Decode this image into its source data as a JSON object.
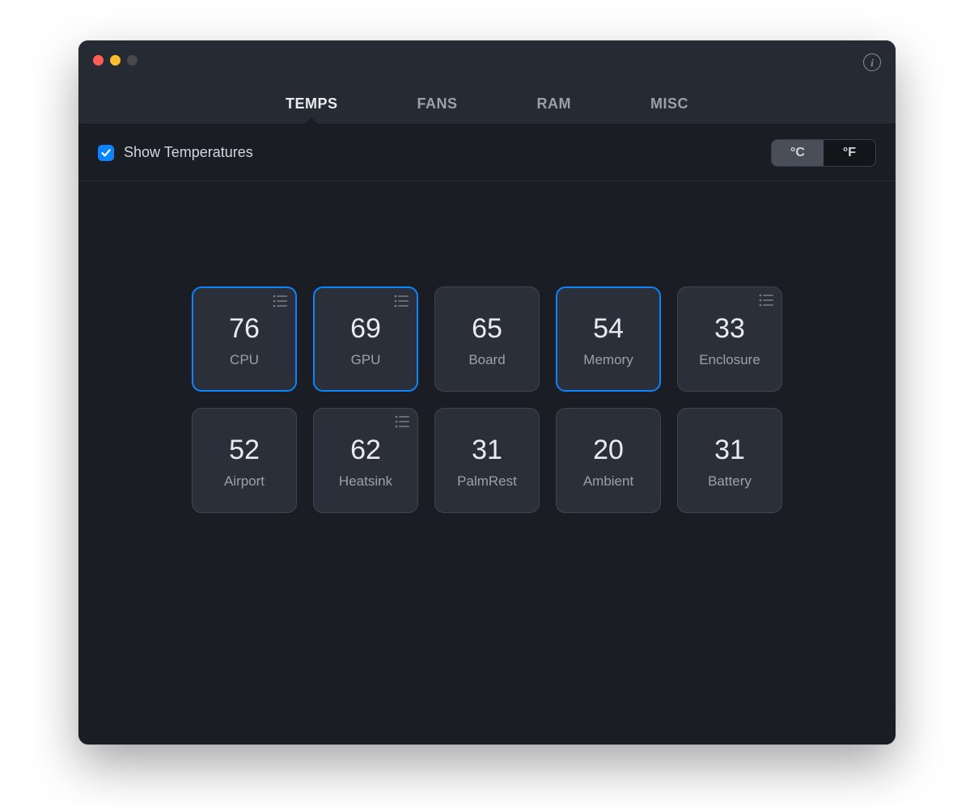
{
  "tabs": [
    {
      "id": "temps",
      "label": "TEMPS",
      "active": true
    },
    {
      "id": "fans",
      "label": "FANS",
      "active": false
    },
    {
      "id": "ram",
      "label": "RAM",
      "active": false
    },
    {
      "id": "misc",
      "label": "MISC",
      "active": false
    }
  ],
  "toolbar": {
    "checkbox_label": "Show Temperatures",
    "checkbox_checked": true,
    "unit_c": "°C",
    "unit_f": "°F",
    "unit_selected": "c"
  },
  "tiles": [
    {
      "id": "cpu",
      "value": "76",
      "label": "CPU",
      "selected": true,
      "has_list": true
    },
    {
      "id": "gpu",
      "value": "69",
      "label": "GPU",
      "selected": true,
      "has_list": true
    },
    {
      "id": "board",
      "value": "65",
      "label": "Board",
      "selected": false,
      "has_list": false
    },
    {
      "id": "memory",
      "value": "54",
      "label": "Memory",
      "selected": true,
      "has_list": false
    },
    {
      "id": "enclosure",
      "value": "33",
      "label": "Enclosure",
      "selected": false,
      "has_list": true
    },
    {
      "id": "airport",
      "value": "52",
      "label": "Airport",
      "selected": false,
      "has_list": false
    },
    {
      "id": "heatsink",
      "value": "62",
      "label": "Heatsink",
      "selected": false,
      "has_list": true
    },
    {
      "id": "palmrest",
      "value": "31",
      "label": "PalmRest",
      "selected": false,
      "has_list": false
    },
    {
      "id": "ambient",
      "value": "20",
      "label": "Ambient",
      "selected": false,
      "has_list": false
    },
    {
      "id": "battery",
      "value": "31",
      "label": "Battery",
      "selected": false,
      "has_list": false
    }
  ],
  "info_icon_text": "i"
}
